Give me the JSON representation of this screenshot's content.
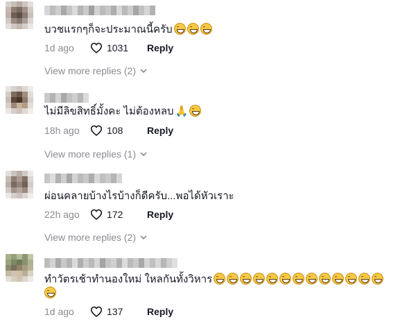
{
  "comments": [
    {
      "text": "บวชแรกๆก็จะประมาณนี้ครับ",
      "emojis": [
        "grin-squint-tears",
        "grin-squint-tears",
        "grin-squint-tears"
      ],
      "time": "1d ago",
      "likes": "1031",
      "reply_label": "Reply",
      "view_more": "View more replies (2)"
    },
    {
      "text": "ไม่มีลิขสิทธิ์มั้งคะ ไม่ต้องหลบ",
      "emojis": [
        "folded-hands",
        "grin-squint"
      ],
      "time": "18h ago",
      "likes": "108",
      "reply_label": "Reply",
      "view_more": "View more replies (1)"
    },
    {
      "text": "ผ่อนคลายบ้างไรบ้างก็ดีครับ...พอได้หัวเราะ",
      "emojis": [],
      "time": "22h ago",
      "likes": "172",
      "reply_label": "Reply",
      "view_more": "View more replies (2)"
    },
    {
      "text": "ทำวัตรเช้าทำนองใหม่ ใหลกันทั้งวิหาร",
      "emojis": [
        "grin-squint-tears",
        "grin-squint-tears",
        "grin-squint-tears",
        "grin-squint-tears",
        "grin-squint-tears",
        "grin-squint-tears",
        "grin-squint-tears",
        "grin-squint",
        "grin-squint",
        "grin-squint",
        "grin-squint",
        "grin-squint",
        "grin-squint",
        "grin-squint"
      ],
      "time": "1d ago",
      "likes": "137",
      "reply_label": "Reply",
      "view_more": ""
    }
  ],
  "colors": {
    "text": "#161823",
    "muted": "#8a8b91",
    "emoji": "#f6c945"
  }
}
